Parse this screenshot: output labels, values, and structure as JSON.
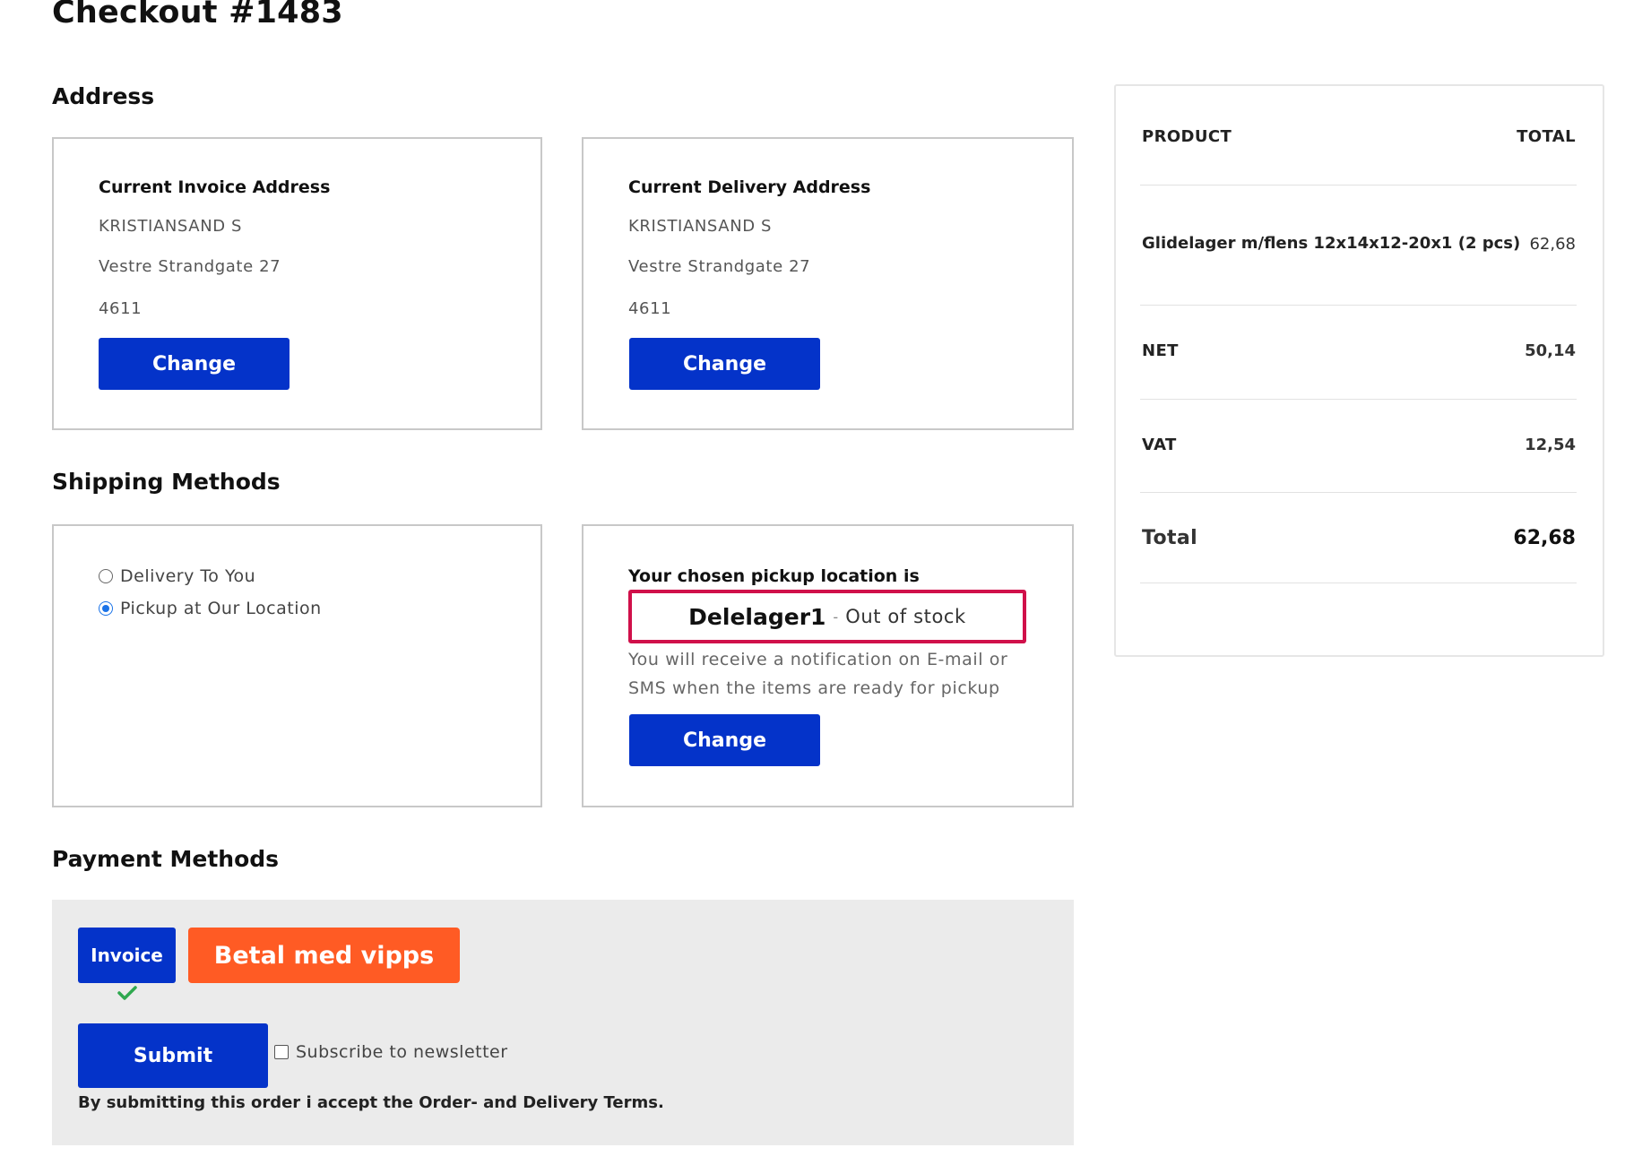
{
  "title": "Checkout #1483",
  "address": {
    "heading": "Address",
    "invoice": {
      "heading": "Current Invoice Address",
      "city": "KRISTIANSAND S",
      "street": "Vestre Strandgate 27",
      "postcode": "4611",
      "change_label": "Change"
    },
    "delivery": {
      "heading": "Current Delivery Address",
      "city": "KRISTIANSAND S",
      "street": "Vestre Strandgate 27",
      "postcode": "4611",
      "change_label": "Change"
    }
  },
  "shipping": {
    "heading": "Shipping Methods",
    "options": [
      {
        "label": "Delivery To You",
        "selected": false
      },
      {
        "label": "Pickup at Our Location",
        "selected": true
      }
    ],
    "pickup": {
      "intro": "Your chosen pickup location is",
      "location": "Delelager1",
      "separator": "-",
      "stock_status": "Out of stock",
      "notice_line1": "You will receive a notification on E-mail or",
      "notice_line2": "SMS when the items are ready for pickup",
      "change_label": "Change"
    }
  },
  "payment": {
    "heading": "Payment Methods",
    "invoice_label": "Invoice",
    "vipps_label": "Betal med vipps",
    "submit_label": "Submit",
    "newsletter_label": "Subscribe to newsletter",
    "newsletter_checked": false,
    "terms_text": "By submitting this order i accept the Order- and Delivery Terms."
  },
  "summary": {
    "col_product": "PRODUCT",
    "col_total": "TOTAL",
    "items": [
      {
        "name": "Glidelager m/flens 12x14x12-20x1 (2 pcs)",
        "total": "62,68"
      }
    ],
    "net_label": "NET",
    "net_value": "50,14",
    "vat_label": "VAT",
    "vat_value": "12,54",
    "total_label": "Total",
    "total_value": "62,68"
  },
  "colors": {
    "primary_button": "#0433c9",
    "vipps_orange": "#ff5b24",
    "pickup_border": "#d0104a",
    "check_green": "#2fa84f"
  }
}
